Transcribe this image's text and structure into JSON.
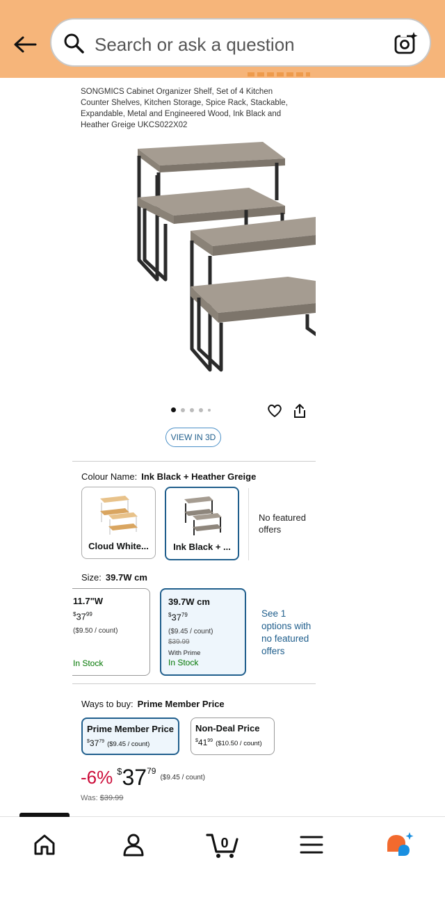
{
  "search": {
    "placeholder": "Search or ask a question"
  },
  "product": {
    "title": "SONGMICS Cabinet Organizer Shelf, Set of 4 Kitchen Counter Shelves, Kitchen Storage, Spice Rack, Stackable, Expandable, Metal and Engineered Wood, Ink Black and Heather Greige UKCS022X02",
    "image_count": 5,
    "active_image_index": 0,
    "view3d_label": "VIEW IN 3D"
  },
  "colour": {
    "label": "Colour Name:",
    "selected": "Ink Black + Heather Greige",
    "options": [
      {
        "label": "Cloud White...",
        "selected": false
      },
      {
        "label": "Ink Black + ...",
        "selected": true
      }
    ],
    "no_featured": "No featured offers"
  },
  "size": {
    "label": "Size:",
    "selected": "39.7W cm",
    "options": [
      {
        "name": "11.7\"W",
        "price_whole": "37",
        "price_cents": "99",
        "per_count": "($9.50 / count)",
        "stock": "In Stock",
        "selected": false
      },
      {
        "name": "39.7W cm",
        "price_whole": "37",
        "price_cents": "79",
        "per_count": "($9.45 / count)",
        "was": "$39.99",
        "prime": "With Prime",
        "stock": "In Stock",
        "selected": true
      }
    ],
    "see_options": "See 1 options with no featured offers"
  },
  "ways_to_buy": {
    "label": "Ways to buy:",
    "selected": "Prime Member Price",
    "options": [
      {
        "title": "Prime Member Price",
        "price_whole": "37",
        "price_cents": "79",
        "per_count": "($9.45 / count)",
        "selected": true
      },
      {
        "title": "Non-Deal Price",
        "price_whole": "41",
        "price_cents": "99",
        "per_count": "($10.50 / count)",
        "selected": false
      }
    ]
  },
  "price": {
    "discount": "-6%",
    "currency": "$",
    "whole": "37",
    "cents": "79",
    "per_count": "($9.45 / count)",
    "was_label": "Was:",
    "was_value": "$39.99"
  },
  "nav": {
    "cart_count": "0",
    "items": [
      "home-icon",
      "account-icon",
      "cart-icon",
      "menu-icon",
      "rufus-assistant-icon"
    ]
  },
  "colors": {
    "header_bg": "#f6b57a",
    "accent_blue": "#1f5e8c",
    "deal_red": "#cc0c39",
    "stock_green": "#007600"
  }
}
